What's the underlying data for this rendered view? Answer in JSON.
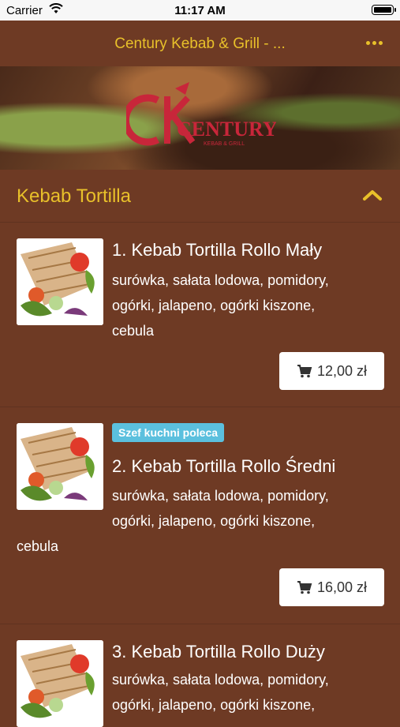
{
  "status_bar": {
    "carrier": "Carrier",
    "time": "11:17 AM"
  },
  "header": {
    "title": "Century Kebab & Grill - ..."
  },
  "section": {
    "title": "Kebab Tortilla"
  },
  "items": [
    {
      "title": "1. Kebab Tortilla Rollo Mały",
      "desc_lines": [
        "surówka, sałata lodowa, pomidory,",
        "ogórki, jalapeno, ogórki kiszone,",
        "cebula"
      ],
      "price": "12,00 zł"
    },
    {
      "badge": "Szef kuchni poleca",
      "title": "2. Kebab Tortilla Rollo Średni",
      "desc_lines": [
        "surówka, sałata lodowa, pomidory,",
        "ogórki, jalapeno, ogórki kiszone,",
        "cebula"
      ],
      "price": "16,00 zł"
    },
    {
      "title": "3. Kebab Tortilla Rollo Duży",
      "desc_lines": [
        "surówka, sałata lodowa, pomidory,",
        "ogórki, jalapeno, ogórki kiszone,"
      ]
    }
  ],
  "colors": {
    "background": "#6e3a24",
    "accent": "#e8c02a",
    "badge": "#5bc0de"
  }
}
